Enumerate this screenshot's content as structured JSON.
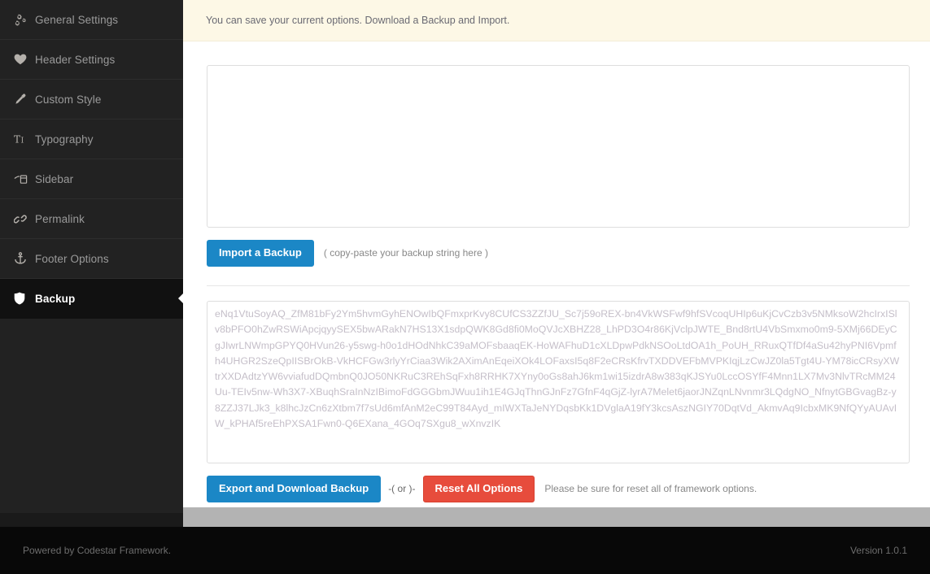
{
  "sidebar": {
    "items": [
      {
        "label": "General Settings",
        "icon": "gears-icon",
        "active": false
      },
      {
        "label": "Header Settings",
        "icon": "heart-icon",
        "active": false
      },
      {
        "label": "Custom Style",
        "icon": "eyedropper-icon",
        "active": false
      },
      {
        "label": "Typography",
        "icon": "text-height-icon",
        "active": false
      },
      {
        "label": "Sidebar",
        "icon": "sidebar-icon",
        "active": false
      },
      {
        "label": "Permalink",
        "icon": "chain-link-icon",
        "active": false
      },
      {
        "label": "Footer Options",
        "icon": "anchor-icon",
        "active": false
      },
      {
        "label": "Backup",
        "icon": "shield-icon",
        "active": true
      }
    ]
  },
  "notice": {
    "text": "You can save your current options. Download a Backup and Import."
  },
  "import_section": {
    "textarea_value": "",
    "textarea_placeholder": "",
    "button_label": "Import a Backup",
    "hint": "( copy-paste your backup string here )"
  },
  "export_section": {
    "textarea_value": "eNq1VtuSoyAQ_ZfM81bFy2Ym5hvmGyhENOwIbQFmxprKvy8CUfCS3ZZfJU_Sc7j59oREX-bn4VkWSFwf9hfSVcoqUHIp6uKjCvCzb3v5NMksoW2hcIrxISlv8bPFO0hZwRSWiApcjqyySEX5bwARakN7HS13X1sdpQWK8Gd8fi0MoQVJcXBHZ28_LhPD3O4r86KjVclpJWTE_Bnd8rtU4VbSmxmo0m9-5XMj66DEyCgJIwrLNWmpGPYQ0HVun26-y5swg-h0o1dHOdNhkC39aMOFsbaaqEK-HoWAFhuD1cXLDpwPdkNSOoLtdOA1h_PoUH_RRuxQTfDf4aSu42hyPNI6Vpmfh4UHGR2SzeQpIISBrOkB-VkHCFGw3rlyYrCiaa3Wik2AXimAnEqeiXOk4LOFaxsI5q8F2eCRsKfrvTXDDVEFbMVPKIqjLzCwJZ0la5Tgt4U-YM78icCRsyXWtrXXDAdtzYW6vviafudDQmbnQ0JO50NKRuC3REhSqFxh8RRHK7XYny0oGs8ahJ6km1wi15izdrA8w383qKJSYu0LccOSYfF4Mnn1LX7Mv3NlvTRcMM24Uu-TEIv5nw-Wh3X7-XBuqhSraInNzIBimoFdGGGbmJWuu1ih1E4GJqThnGJnFz7GfnF4qGjZ-lyrA7Melet6jaorJNZqnLNvnmr3LQdgNO_NfnytGBGvagBz-y8ZZJ37LJk3_k8lhcJzCn6zXtbm7f7sUd6mfAnM2eC99T84Ayd_mIWXTaJeNYDqsbKk1DVglaA19fY3kcsAszNGIY70DqtVd_AkmvAq9IcbxMK9NfQYyAUAvIW_kPHAf5reEhPXSA1Fwn0-Q6EXana_4GOq7SXgu8_wXnvzIK"
  },
  "export_buttons": {
    "export_label": "Export and Download Backup",
    "or_text": "-( or )-",
    "reset_label": "Reset All Options",
    "reset_hint": "Please be sure for reset all of framework options."
  },
  "footer": {
    "left": "Powered by Codestar Framework.",
    "right": "Version 1.0.1"
  },
  "colors": {
    "sidebar_bg": "#222222",
    "sidebar_active_bg": "#111111",
    "notice_bg": "#fdf8e6",
    "primary": "#1b87c6",
    "danger": "#e74c3c",
    "footer_bg": "#080808"
  }
}
